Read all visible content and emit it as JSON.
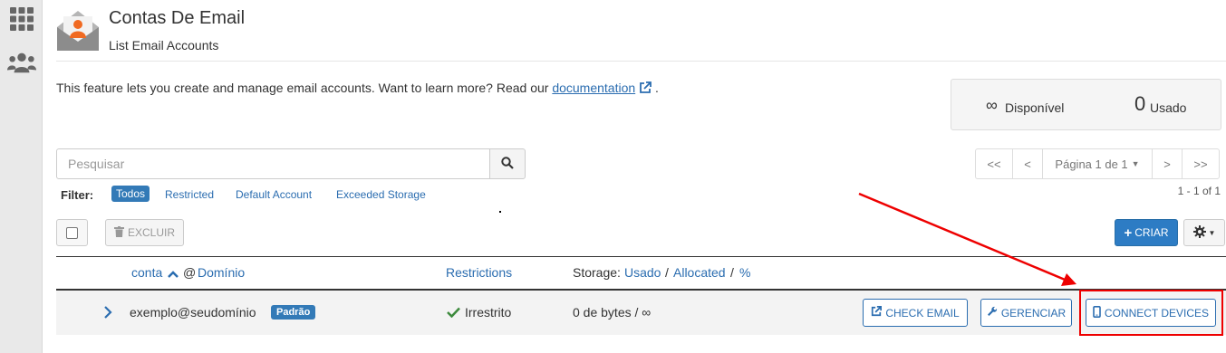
{
  "sidebar": {
    "icons": [
      "apps-grid-icon",
      "users-icon"
    ]
  },
  "header": {
    "title": "Contas De Email",
    "subtitle": "List Email Accounts"
  },
  "intro": {
    "text": "This feature lets you create and manage email accounts. Want to learn more? Read our ",
    "link": "documentation",
    "end": "."
  },
  "stats": {
    "available_symbol": "∞",
    "available_label": "Disponível",
    "used_value": "0",
    "used_label": "Usado"
  },
  "search": {
    "placeholder": "Pesquisar"
  },
  "pager": {
    "first": "<<",
    "prev": "<",
    "page_label": "Página 1 de 1",
    "next": ">",
    "last": ">>"
  },
  "filter": {
    "label": "Filter:",
    "options": [
      "Todos",
      "Restricted",
      "Default Account",
      "Exceeded Storage"
    ],
    "active": "Todos"
  },
  "count_text": "1 - 1 of 1",
  "toolbar": {
    "delete_label": "EXCLUIR",
    "create_label": "CRIAR"
  },
  "table": {
    "col_account": "conta",
    "col_at": "@",
    "col_domain": "Domínio",
    "col_restrictions": "Restrictions",
    "col_storage_prefix": "Storage:",
    "col_storage_used": "Usado",
    "col_storage_sep": "/",
    "col_storage_allocated": "Allocated",
    "col_storage_sep2": "/",
    "col_storage_pct": "%"
  },
  "row": {
    "email": "exemplo@seudomínio",
    "badge": "Padrão",
    "restriction": "Irrestrito",
    "storage": "0 de bytes / ∞",
    "check_email": "CHECK EMAIL",
    "manage": "GERENCIAR",
    "connect": "CONNECT DEVICES"
  },
  "colors": {
    "accent": "#2d7cc4",
    "link": "#2b6db0",
    "highlight": "#e00000",
    "ok": "#3c8a3c"
  }
}
